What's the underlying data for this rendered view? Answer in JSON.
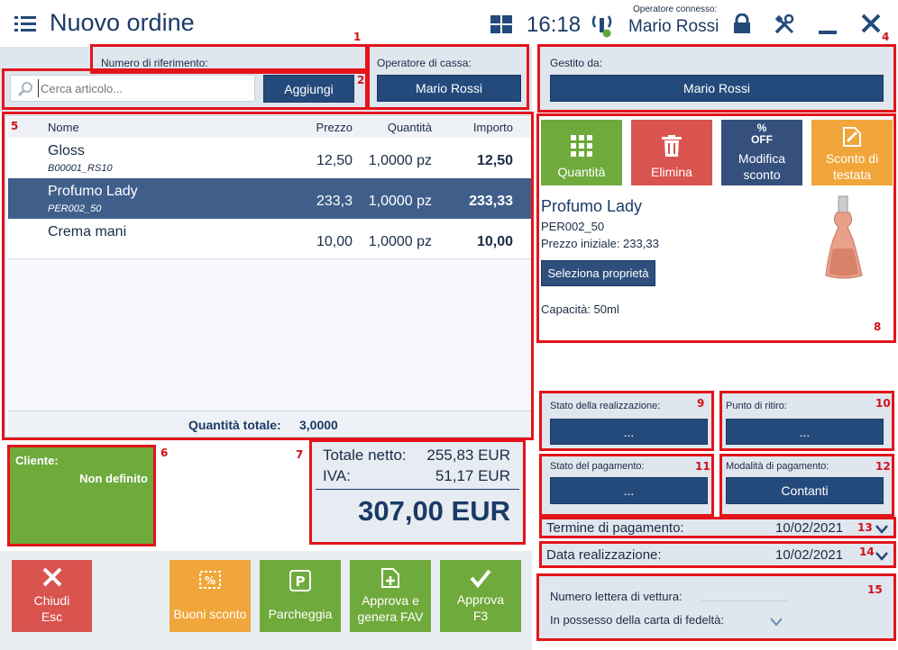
{
  "header": {
    "title": "Nuovo ordine",
    "time": "16:18",
    "operator_label": "Operatore connesso:",
    "operator_name": "Mario Rossi"
  },
  "reference": {
    "label": "Numero di riferimento:"
  },
  "search": {
    "placeholder": "Cerca articolo...",
    "add_label": "Aggiungi"
  },
  "cashier": {
    "label": "Operatore di cassa:",
    "value": "Mario Rossi"
  },
  "managed_by": {
    "label": "Gestito da:",
    "value": "Mario Rossi"
  },
  "table": {
    "columns": {
      "name": "Nome",
      "price": "Prezzo",
      "quantity": "Quantità",
      "amount": "Importo"
    },
    "rows": [
      {
        "name": "Gloss",
        "code": "B00001_RS10",
        "price": "12,50",
        "quantity": "1,0000 pz",
        "amount": "12,50"
      },
      {
        "name": "Profumo Lady",
        "code": "PER002_50",
        "price": "233,3",
        "quantity": "1,0000 pz",
        "amount": "233,33"
      },
      {
        "name": "Crema mani",
        "code": "",
        "price": "10,00",
        "quantity": "1,0000 pz",
        "amount": "10,00"
      }
    ],
    "total_qty_label": "Quantità totale:",
    "total_qty_value": "3,0000"
  },
  "customer": {
    "label": "Cliente:",
    "value": "Non definito"
  },
  "totals": {
    "net_label": "Totale netto:",
    "net_value": "255,83 EUR",
    "vat_label": "IVA:",
    "vat_value": "51,17 EUR",
    "grand_total": "307,00 EUR"
  },
  "actions": {
    "quantity": "Quantità",
    "delete": "Elimina",
    "discount": "Modifica sconto",
    "discount_icon": "OFF",
    "header_discount": "Sconto di testata"
  },
  "item_detail": {
    "name": "Profumo Lady",
    "code": "PER002_50",
    "initial_price": "Prezzo iniziale: 233,33",
    "select_properties": "Seleziona proprietà",
    "capacity": "Capacità: 50ml"
  },
  "fulfillment_status": {
    "label": "Stato della realizzazione:",
    "value": "..."
  },
  "pickup_point": {
    "label": "Punto di ritiro:",
    "value": "..."
  },
  "payment_status": {
    "label": "Stato del pagamento:",
    "value": "..."
  },
  "payment_method": {
    "label": "Modalità di pagamento:",
    "value": "Contanti"
  },
  "payment_term": {
    "label": "Termine di pagamento:",
    "value": "10/02/2021"
  },
  "fulfillment_date": {
    "label": "Data realizzazione:",
    "value": "10/02/2021"
  },
  "extra": {
    "waybill_label": "Numero lettera di vettura:",
    "loyalty_label": "In possesso della carta di fedeltà:"
  },
  "footer": {
    "close": "Chiudi",
    "close_key": "Esc",
    "vouchers": "Buoni sconto",
    "park": "Parcheggia",
    "approve_invoice_1": "Approva e",
    "approve_invoice_2": "genera FAV",
    "approve": "Approva",
    "approve_key": "F3"
  },
  "markers": [
    "1",
    "2",
    "4",
    "5",
    "6",
    "7",
    "8",
    "9",
    "10",
    "11",
    "12",
    "13",
    "14",
    "15"
  ],
  "colors": {
    "accent_blue": "#244a7c",
    "selected_row": "#3f5f8a",
    "green": "#6faa3c",
    "red": "#d9534f",
    "navy_tile": "#35507d",
    "orange": "#f0a63a",
    "highlight_red": "#e3141b"
  }
}
